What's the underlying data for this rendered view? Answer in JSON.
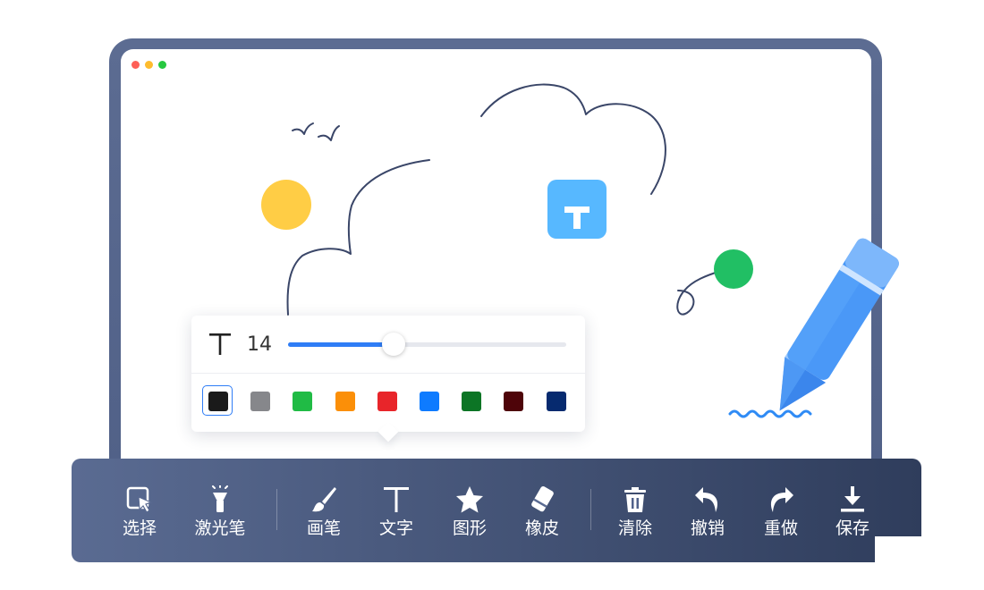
{
  "window": {
    "controls": [
      "close",
      "minimize",
      "maximize"
    ]
  },
  "canvas_elements": {
    "text_tile_icon": "text-T-icon"
  },
  "text_settings": {
    "font_icon": "text-T-icon",
    "font_size": "14",
    "slider_fraction": 0.38,
    "colors": [
      {
        "name": "black",
        "hex": "#1a1a1a",
        "selected": true
      },
      {
        "name": "gray",
        "hex": "#86878b",
        "selected": false
      },
      {
        "name": "green",
        "hex": "#20bb45",
        "selected": false
      },
      {
        "name": "orange",
        "hex": "#fb8f08",
        "selected": false
      },
      {
        "name": "red",
        "hex": "#e8252a",
        "selected": false
      },
      {
        "name": "blue",
        "hex": "#0e7bff",
        "selected": false
      },
      {
        "name": "dark-green",
        "hex": "#0c7525",
        "selected": false
      },
      {
        "name": "maroon",
        "hex": "#4e0409",
        "selected": false
      },
      {
        "name": "navy",
        "hex": "#062a6f",
        "selected": false
      }
    ]
  },
  "toolbar": {
    "tools": [
      {
        "id": "select",
        "label": "选择",
        "icon": "cursor-select-icon"
      },
      {
        "id": "laser",
        "label": "激光笔",
        "icon": "laser-pointer-icon"
      },
      {
        "id": "brush",
        "label": "画笔",
        "icon": "brush-icon"
      },
      {
        "id": "text",
        "label": "文字",
        "icon": "text-T-icon"
      },
      {
        "id": "shape",
        "label": "图形",
        "icon": "star-icon"
      },
      {
        "id": "eraser",
        "label": "橡皮",
        "icon": "eraser-icon"
      },
      {
        "id": "clear",
        "label": "清除",
        "icon": "trash-icon"
      },
      {
        "id": "undo",
        "label": "撤销",
        "icon": "undo-icon"
      },
      {
        "id": "redo",
        "label": "重做",
        "icon": "redo-icon"
      },
      {
        "id": "save",
        "label": "保存",
        "icon": "download-icon"
      }
    ]
  },
  "colors": {
    "accent": "#2f7df6",
    "frame": "#56668c",
    "text_tile": "#57b8ff",
    "sun": "#ffcd45",
    "green_dot": "#21bf64",
    "pencil": "#4a98f7"
  }
}
